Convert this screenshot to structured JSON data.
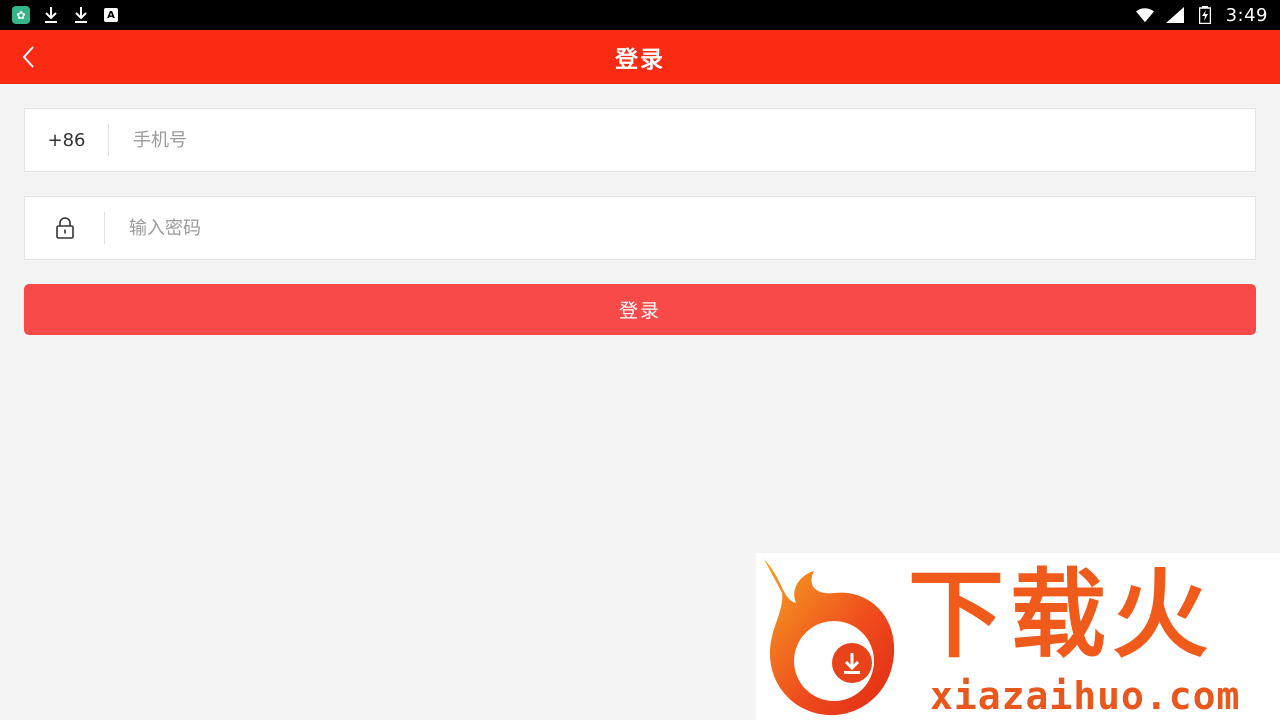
{
  "status_bar": {
    "time": "3:49",
    "icons": [
      "app-icon",
      "download-icon",
      "download-icon",
      "a-icon",
      "wifi-icon",
      "signal-icon",
      "battery-icon"
    ]
  },
  "header": {
    "title": "登录",
    "back_icon": "chevron-left-icon"
  },
  "form": {
    "phone_prefix": "+86",
    "phone_placeholder": "手机号",
    "phone_value": "",
    "password_placeholder": "输入密码",
    "password_value": "",
    "lock_icon": "lock-icon",
    "login_label": "登录"
  },
  "colors": {
    "header_bg": "#fa2a13",
    "button_bg": "#f94a4a",
    "page_bg": "#f4f4f4"
  },
  "watermark": {
    "cn_text": "下载火",
    "en_text": "xiazaihuo.com"
  }
}
